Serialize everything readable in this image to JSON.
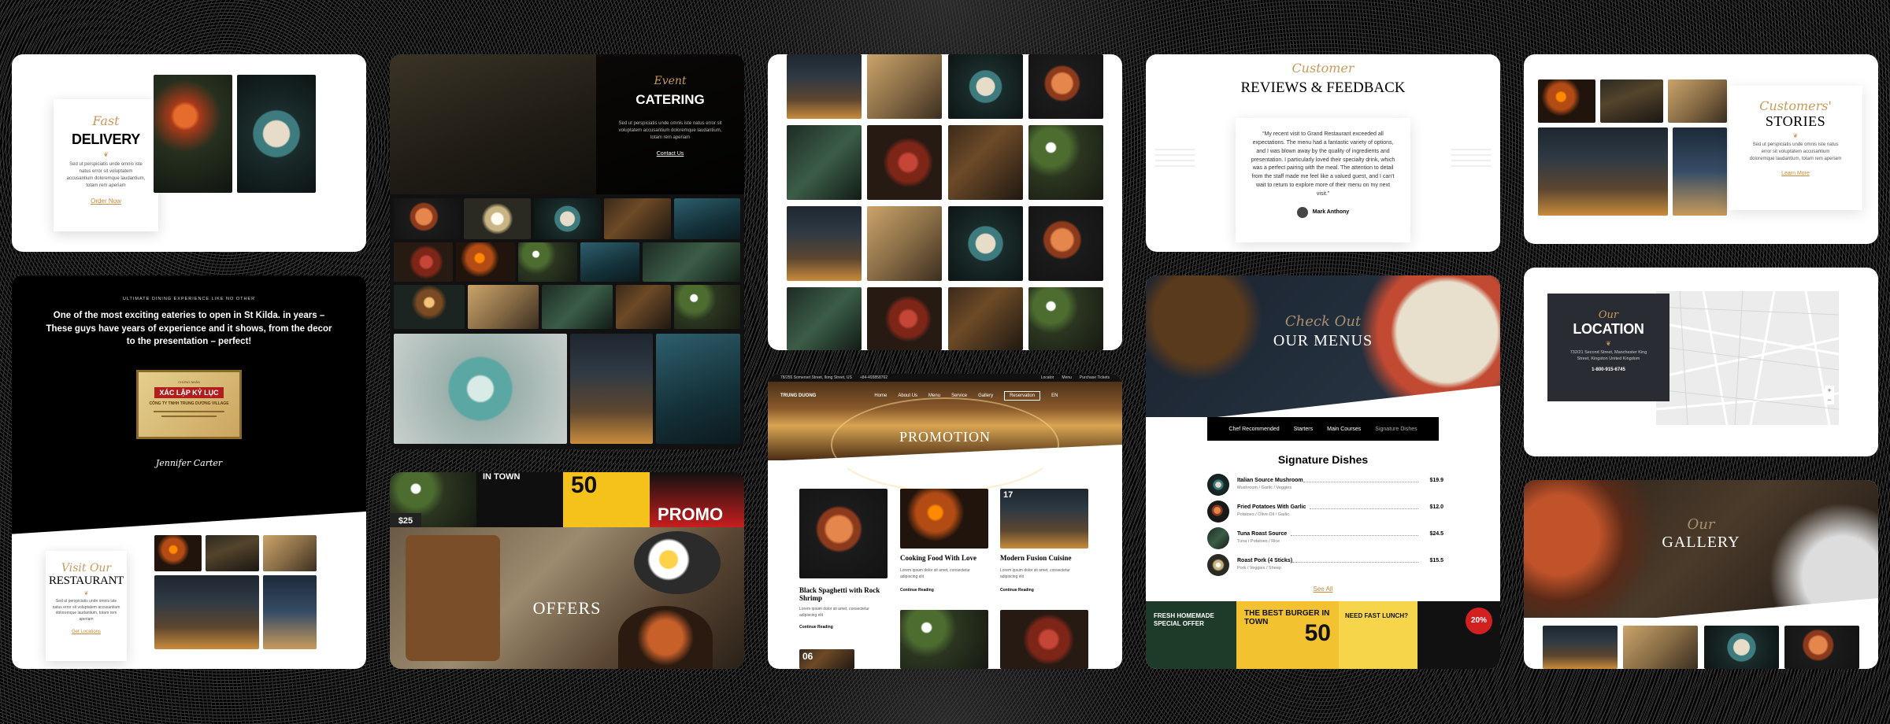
{
  "delivery": {
    "script": "Fast",
    "title": "DELIVERY",
    "body": "Sed ut perspiciatis unde omnis iste natus error sit voluptatem accusantium doloremque laudantium, totam rem aperiam",
    "link": "Order Now"
  },
  "testimonial": {
    "kicker": "ULTIMATE DINING EXPERIENCE LIKE NO OTHER",
    "quote": "One of the most exciting eateries to open in St Kilda. in years – These guys have years of experience and it shows, from the decor to the presentation – perfect!",
    "cert_title": "XÁC LẬP KỶ LỤC",
    "cert_sub": "CÔNG TY TNHH TRUNG DƯƠNG VILLAGE",
    "signature": "Jennifer Carter"
  },
  "restaurant": {
    "script": "Visit Our",
    "title": "RESTAURANT",
    "body": "Sed ut perspiciatis unde omnis iste natus error sit voluptatem accusantium doloremque laudantium, totam rem aperiam",
    "link": "Get Locations"
  },
  "catering": {
    "script": "Event",
    "title": "CATERING",
    "body": "Sed ut perspiciatis unde omnis iste natus error sit voluptatem accusantium doloremque laudantium, totam rem aperiam",
    "link": "Contact Us"
  },
  "offers": {
    "title": "OFFERS",
    "promo_word": "PROMO",
    "in_town": "IN TOWN",
    "fifty": "50",
    "price_a": "$25"
  },
  "promotion": {
    "topbar_address": "78/255 Somerset Street, Ilong Street, US",
    "topbar_phone": "+84-493858762",
    "topbar_links": [
      "Locator",
      "Menu",
      "Purchase Tickets"
    ],
    "logo": "TRUNG DUONG",
    "nav": [
      "Home",
      "About Us",
      "Menu",
      "Service",
      "Gallery"
    ],
    "reserve": "Reservation",
    "lang": "EN",
    "title": "PROMOTION",
    "posts": [
      {
        "title": "Black Spaghetti with Rock Shrimp",
        "excerpt": "Lorem ipsum dolor sit amet, consectetur adipiscing elit",
        "link": "Continue Reading"
      },
      {
        "title": "Cooking Food With Love",
        "excerpt": "Lorem ipsum dolor sit amet, consectetur adipiscing elit",
        "link": "Continue Reading"
      },
      {
        "title": "Modern Fusion Cuisine",
        "excerpt": "Lorem ipsum dolor sit amet, consectetur adipiscing elit",
        "link": "Continue Reading"
      }
    ],
    "date_a": "06",
    "date_b": "17"
  },
  "reviews": {
    "script": "Customer",
    "title": "REVIEWS & FEEDBACK",
    "quote": "“My recent visit to Grand Restaurant exceeded all expectations. The menu had a fantastic variety of options, and I was blown away by the quality of ingredients and presentation. I particularly loved their specialty drink, which was a perfect pairing with the meal. The attention to detail from the staff made me feel like a valued guest, and I can't wait to return to explore more of their menu on my next visit.”",
    "author": "Mark Anthony"
  },
  "menus": {
    "script": "Check Out",
    "title": "OUR MENUS",
    "tabs": [
      "Chef Recommended",
      "Starters",
      "Main Courses",
      "Signature Dishes"
    ],
    "heading": "Signature Dishes",
    "items": [
      {
        "name": "Italian Source Mushroom",
        "desc": "Mushroom / Garlic / Veggies",
        "price": "$19.9"
      },
      {
        "name": "Fried Potatoes With Garlic",
        "desc": "Potatoes / Olive Oil / Garlic",
        "price": "$12.0"
      },
      {
        "name": "Tuna Roast Source",
        "desc": "Tuna / Potatoes / Rice",
        "price": "$24.5"
      },
      {
        "name": "Roast Pork (4 Sticks)",
        "desc": "Pork / Veggies / Sheep",
        "price": "$15.5"
      }
    ],
    "see_all": "See All",
    "banner_left": "FRESH HOMEMADE SPECIAL OFFER",
    "banner_best": "THE BEST BURGER IN TOWN",
    "banner_fifty": "50",
    "banner_lunch": "NEED FAST LUNCH?",
    "banner_pct": "20%"
  },
  "stories": {
    "script": "Customers'",
    "title": "STORIES",
    "body": "Sed ut perspiciatis unde omnis iste natus error sit voluptatem accusantium doloremque laudantium, totam rem aperiam",
    "link": "Learn More"
  },
  "location": {
    "script": "Our",
    "title": "LOCATION",
    "address": "732/21 Second Street, Manchester King Street, Kingston United Kingdom",
    "phone": "1-800-915-6745"
  },
  "gallery": {
    "script": "Our",
    "title": "GALLERY"
  }
}
